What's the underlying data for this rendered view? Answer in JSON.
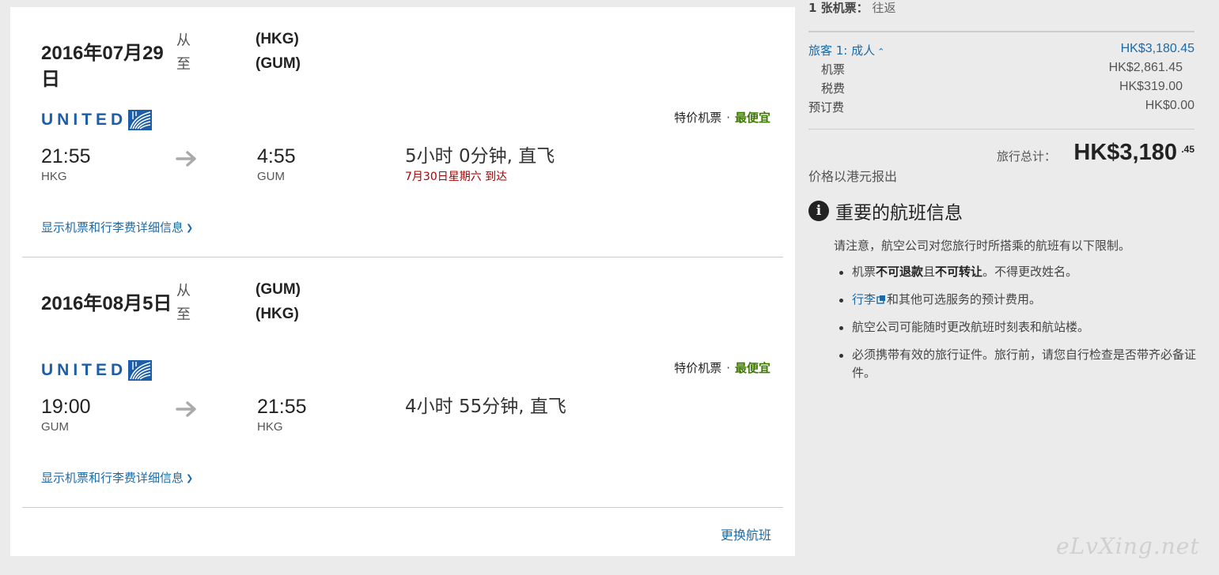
{
  "legs": [
    {
      "date": "2016年07月29日",
      "from_label": "从",
      "to_label": "至",
      "from_code": "(HKG)",
      "to_code": "(GUM)",
      "airline": "UNITED",
      "fare_type": "特价机票",
      "fare_dot": "·",
      "cheapest": "最便宜",
      "depart_time": "21:55",
      "depart_airport": "HKG",
      "arrive_time": "4:55",
      "arrive_airport": "GUM",
      "duration": "5小时 0分钟, 直飞",
      "arrival_note": "7月30日星期六 到达",
      "details_link": "显示机票和行李费详细信息"
    },
    {
      "date": "2016年08月5日",
      "from_label": "从",
      "to_label": "至",
      "from_code": "(GUM)",
      "to_code": "(HKG)",
      "airline": "UNITED",
      "fare_type": "特价机票",
      "fare_dot": "·",
      "cheapest": "最便宜",
      "depart_time": "19:00",
      "depart_airport": "GUM",
      "arrive_time": "21:55",
      "arrive_airport": "HKG",
      "duration": "4小时 55分钟, 直飞",
      "arrival_note": "",
      "details_link": "显示机票和行李费详细信息"
    }
  ],
  "change_flight": "更换航班",
  "summary": {
    "ticket_count_label": "1 张机票：",
    "trip_type": "往返",
    "traveler_label": "旅客 1: 成人",
    "traveler_amount": "HK$3,180.45",
    "ticket_label": "机票",
    "ticket_amount": "HK$2,861.45",
    "tax_label": "税费",
    "tax_amount": "HK$319.00",
    "booking_fee_label": "预订费",
    "booking_fee_amount": "HK$0.00",
    "total_label": "旅行总计：",
    "total_main": "HK$3,180",
    "total_cents": ".45",
    "currency_note": "价格以港元报出"
  },
  "info": {
    "title": "重要的航班信息",
    "intro": "请注意，航空公司对您旅行时所搭乘的航班有以下限制。",
    "item1_pre": "机票",
    "item1_bold1": "不可退款",
    "item1_mid": "且",
    "item1_bold2": "不可转让",
    "item1_post": "。不得更改姓名。",
    "item2_link": "行李",
    "item2_post": "和其他可选服务的预计费用。",
    "item3": "航空公司可能随时更改航班时刻表和航站楼。",
    "item4": "必须携带有效的旅行证件。旅行前，请您自行检查是否带齐必备证件。"
  },
  "watermark": "eLvXing.net",
  "colors": {
    "link": "#1c6aa8",
    "airline_blue": "#1c5ea8",
    "cheapest_green": "#3d7a00",
    "arrival_red": "#a60000"
  }
}
